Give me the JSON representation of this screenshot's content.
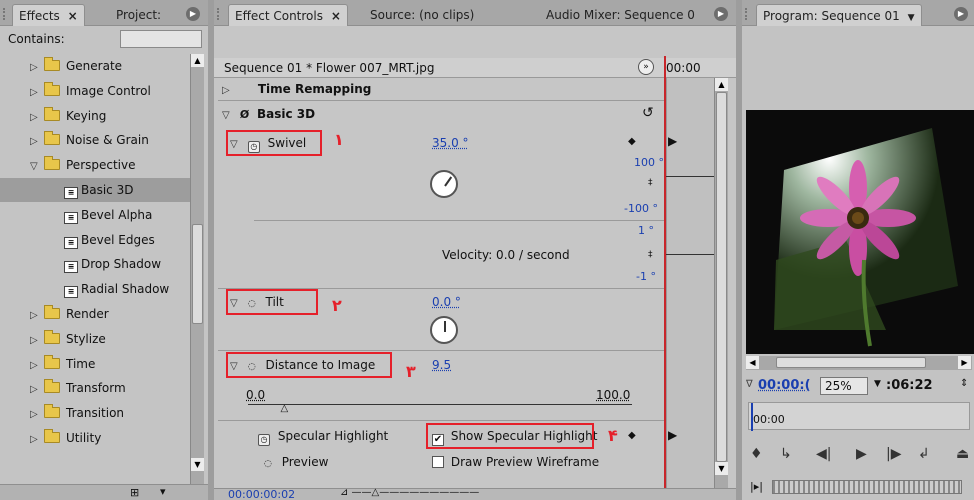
{
  "effects_panel": {
    "tab_effects": "Effects",
    "tab_close": "×",
    "tab_project": "Project: ",
    "contains_label": "Contains:",
    "items": [
      {
        "label": "Generate",
        "kind": "folder",
        "expanded": false
      },
      {
        "label": "Image Control",
        "kind": "folder",
        "expanded": false
      },
      {
        "label": "Keying",
        "kind": "folder",
        "expanded": false
      },
      {
        "label": "Noise & Grain",
        "kind": "folder",
        "expanded": false
      },
      {
        "label": "Perspective",
        "kind": "folder",
        "expanded": true
      },
      {
        "label": "Basic 3D",
        "kind": "effect",
        "selected": true
      },
      {
        "label": "Bevel Alpha",
        "kind": "effect"
      },
      {
        "label": "Bevel Edges",
        "kind": "effect"
      },
      {
        "label": "Drop Shadow",
        "kind": "effect"
      },
      {
        "label": "Radial Shadow",
        "kind": "effect"
      },
      {
        "label": "Render",
        "kind": "folder",
        "expanded": false
      },
      {
        "label": "Stylize",
        "kind": "folder",
        "expanded": false
      },
      {
        "label": "Time",
        "kind": "folder",
        "expanded": false
      },
      {
        "label": "Transform",
        "kind": "folder",
        "expanded": false
      },
      {
        "label": "Transition",
        "kind": "folder",
        "expanded": false
      },
      {
        "label": "Utility",
        "kind": "folder",
        "expanded": false
      }
    ]
  },
  "effect_controls": {
    "tab_effect_controls": "Effect Controls",
    "tab_close": "×",
    "tab_source": "Source: (no clips)",
    "tab_audio_mixer": "Audio Mixer: Sequence 0",
    "clip_title": "Sequence 01 * Flower 007_MRT.jpg",
    "header_timecode": "00:00",
    "time_remapping": "Time Remapping",
    "effect_name": "Basic 3D",
    "swivel": {
      "label": "Swivel",
      "value": "35.0 °",
      "max": "100 °",
      "min": "-100 °",
      "vel_max": "1 °",
      "vel_min": "-1 °",
      "angle_deg": 35
    },
    "velocity_text": "Velocity: 0.0 / second",
    "tilt": {
      "label": "Tilt",
      "value": "0.0 °",
      "angle_deg": 0
    },
    "distance": {
      "label": "Distance to Image",
      "value": "9.5",
      "slider_min": "0.0",
      "slider_max": "100.0",
      "slider_fraction": 0.095
    },
    "specular": {
      "label": "Specular Highlight",
      "checkbox_label": "Show Specular Highlight",
      "checked": true
    },
    "preview": {
      "label": "Preview",
      "checkbox_label": "Draw Preview Wireframe",
      "checked": false
    },
    "bottom_timecode": "00:00:00:02",
    "annotation_numbers": [
      "١",
      "٢",
      "٣",
      "۴"
    ]
  },
  "program_monitor": {
    "tab_label": "Program: Sequence 01",
    "timecode": "00:00:(",
    "zoom": "25%",
    "duration": ":06:22",
    "ruler_time": "00:00"
  },
  "colors": {
    "accent_red": "#e5202a",
    "value_blue": "#1a3fb0",
    "timeline_red": "#c8262b"
  }
}
